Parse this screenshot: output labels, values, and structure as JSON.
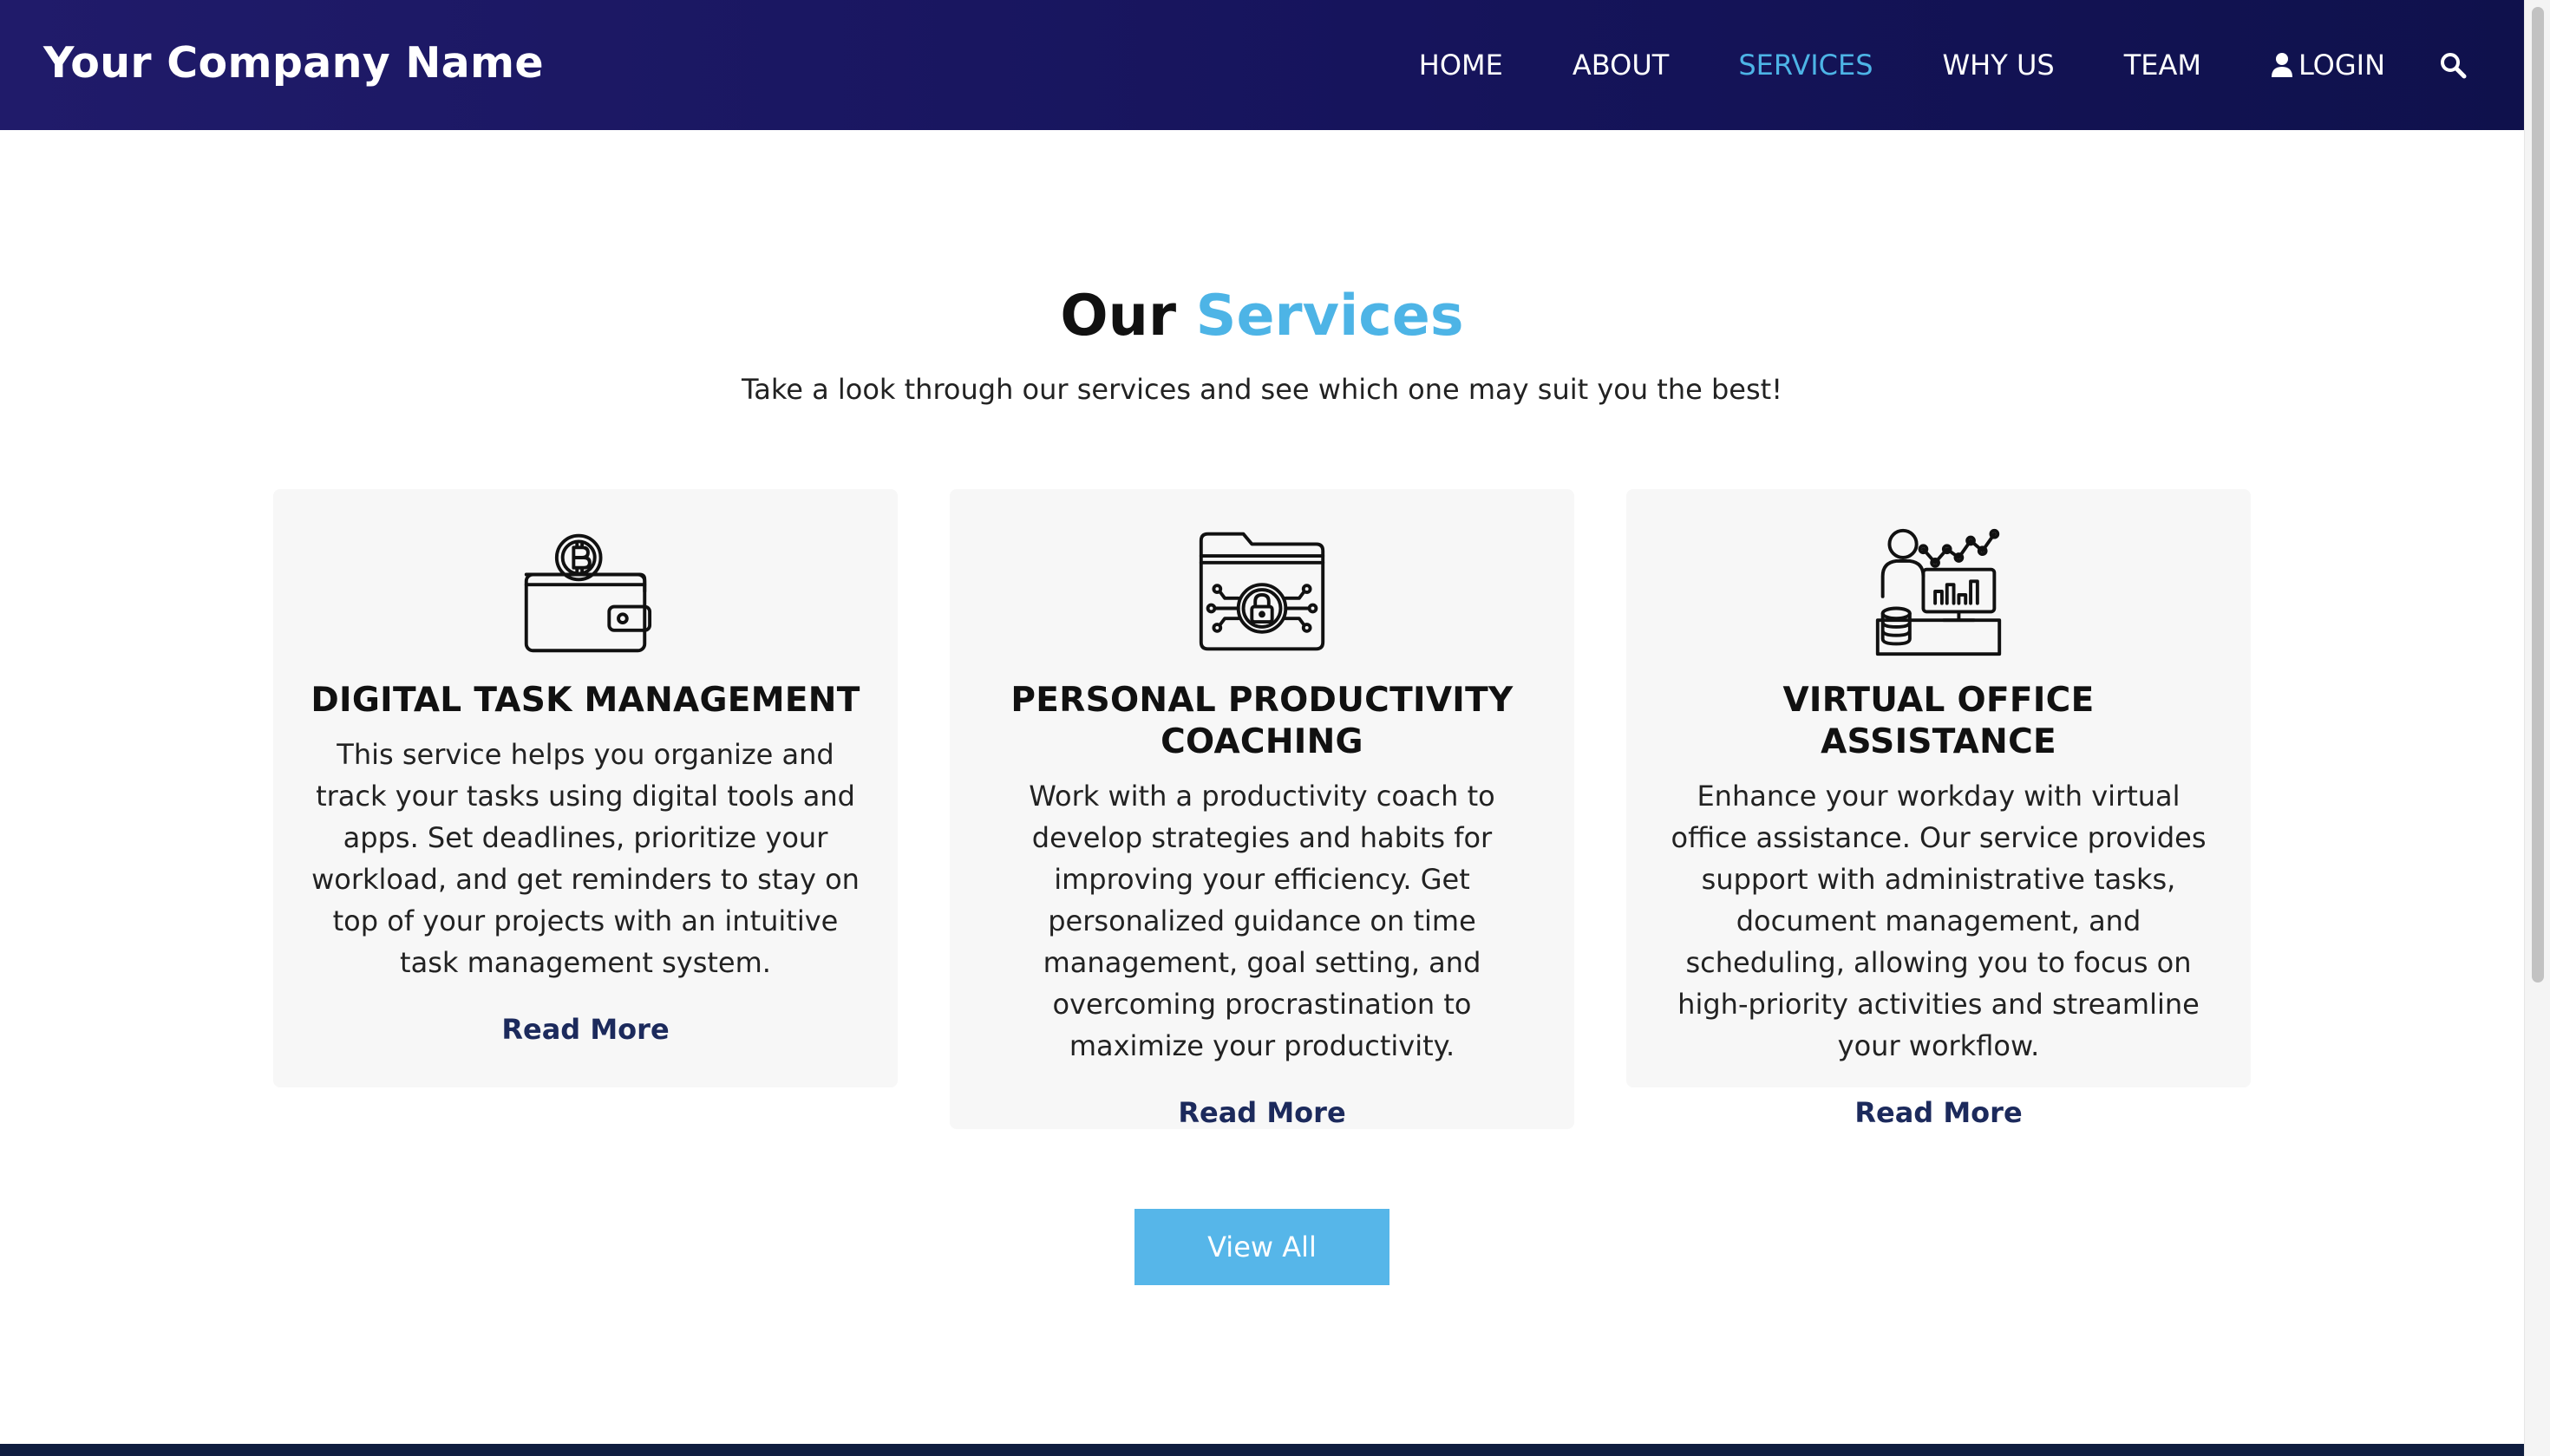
{
  "header": {
    "brand": "Your Company Name",
    "nav": [
      {
        "label": "HOME"
      },
      {
        "label": "ABOUT"
      },
      {
        "label": "SERVICES"
      },
      {
        "label": "WHY US"
      },
      {
        "label": "TEAM"
      },
      {
        "label": "LOGIN"
      }
    ],
    "active_nav": "SERVICES",
    "icons": {
      "login": "user-icon",
      "search": "search-icon"
    }
  },
  "section": {
    "title_main": "Our",
    "title_accent": "Services",
    "subtitle": "Take a look through our services and see which one may suit you the best!"
  },
  "cards": [
    {
      "icon": "wallet-bitcoin-icon",
      "title": "DIGITAL TASK MANAGEMENT",
      "text": "This service helps you organize and track your tasks using digital tools and apps. Set deadlines, prioritize your workload, and get reminders to stay on top of your projects with an intuitive task management system.",
      "link": "Read More"
    },
    {
      "icon": "secure-folder-icon",
      "title": "PERSONAL PRODUCTIVITY COACHING",
      "text": "Work with a productivity coach to develop strategies and habits for improving your efficiency. Get personalized guidance on time management, goal setting, and overcoming procrastination to maximize your productivity.",
      "link": "Read More"
    },
    {
      "icon": "analytics-workstation-icon",
      "title": "VIRTUAL OFFICE ASSISTANCE",
      "text": "Enhance your workday with virtual office assistance. Our service provides support with administrative tasks, document management, and scheduling, allowing you to focus on high-priority activities and streamline your workflow.",
      "link": "Read More"
    }
  ],
  "view_all_label": "View All",
  "colors": {
    "header_bg": "#16145c",
    "accent": "#4db4e6",
    "button": "#56b6e9",
    "card_bg": "#f7f7f7",
    "link": "#1c2a5c",
    "footer": "#0f1d3f"
  }
}
